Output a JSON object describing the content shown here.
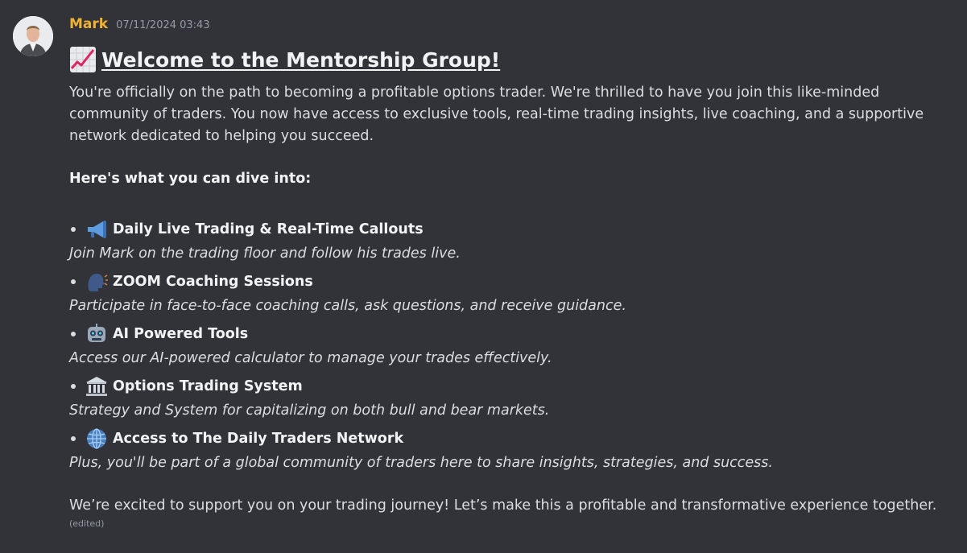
{
  "author": {
    "name": "Mark",
    "timestamp": "07/11/2024 03:43"
  },
  "message": {
    "title": " Welcome to the Mentorship Group!",
    "intro": "You're officially on the path to becoming a profitable options trader. We're thrilled to have you join this like-minded community of traders. You now have access to exclusive tools, real-time trading insights, live coaching, and a supportive network dedicated to helping you succeed.",
    "section_heading": "Here's what you can dive into:",
    "items": [
      {
        "icon": "megaphone-icon",
        "title": "Daily Live Trading & Real-Time Callouts",
        "desc": "Join Mark on the trading floor and follow his trades live."
      },
      {
        "icon": "speaking-head-icon",
        "title": "ZOOM Coaching Sessions",
        "desc": "Participate in face-to-face coaching calls, ask questions, and receive guidance."
      },
      {
        "icon": "robot-icon",
        "title": "AI Powered Tools",
        "desc": "Access our AI-powered calculator to manage your trades effectively."
      },
      {
        "icon": "classical-building-icon",
        "title": "Options Trading System",
        "desc": "Strategy and System for capitalizing on both bull and bear markets."
      },
      {
        "icon": "globe-icon",
        "title": "Access to The Daily Traders Network",
        "desc": "Plus, you'll be part of a global community of traders here to share insights, strategies, and success."
      }
    ],
    "closing": "We’re excited to support you on your trading journey! Let’s make this a profitable and transformative experience together.",
    "edited_label": "(edited)"
  },
  "colors": {
    "background": "#323339",
    "username": "#f0b232",
    "text": "#dbdee1",
    "muted": "#949ba4"
  }
}
